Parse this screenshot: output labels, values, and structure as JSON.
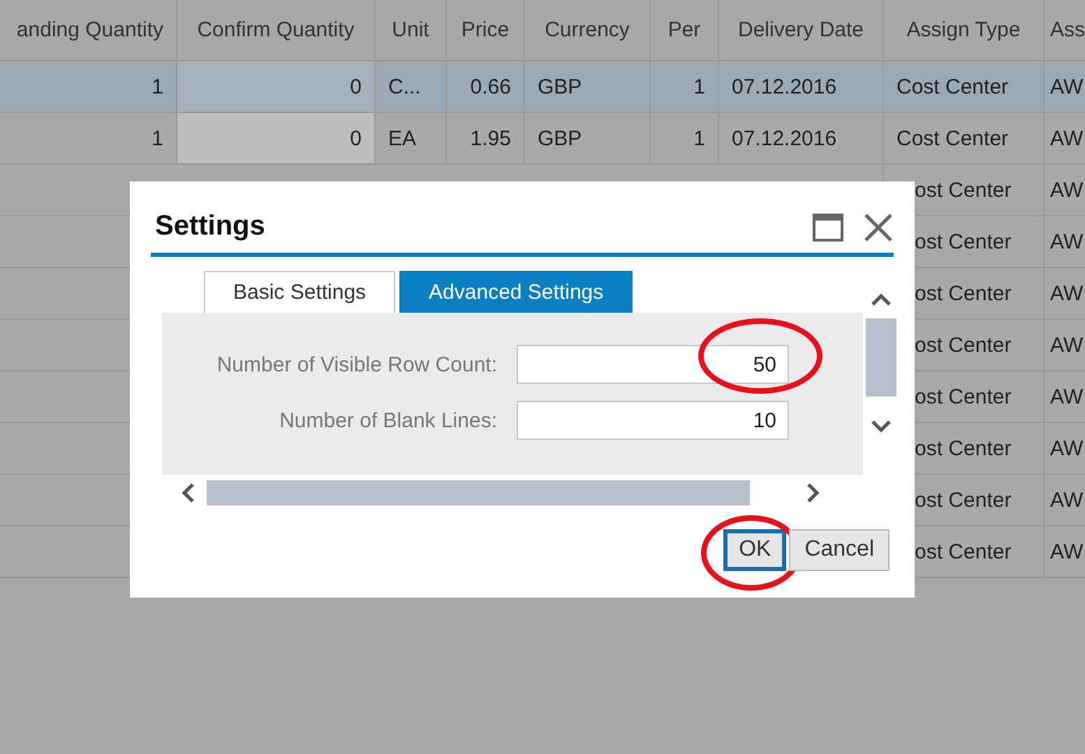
{
  "table": {
    "columns": [
      "anding Quantity",
      "Confirm Quantity",
      "Unit",
      "Price",
      "Currency",
      "Per",
      "Delivery Date",
      "Assign Type",
      "Ass"
    ],
    "rows": [
      {
        "kind": "full",
        "selected": true,
        "cells": [
          "1",
          "0",
          "C...",
          "0.66",
          "GBP",
          "1",
          "07.12.2016",
          "Cost Center",
          "AW"
        ]
      },
      {
        "kind": "full",
        "selected": false,
        "cells": [
          "1",
          "0",
          "EA",
          "1.95",
          "GBP",
          "1",
          "07.12.2016",
          "Cost Center",
          "AW"
        ]
      },
      {
        "kind": "covered",
        "selected": false,
        "cells": [
          "ost Center",
          "AW"
        ]
      },
      {
        "kind": "covered",
        "selected": false,
        "cells": [
          "ost Center",
          "AW"
        ]
      },
      {
        "kind": "covered",
        "selected": false,
        "cells": [
          "ost Center",
          "AW"
        ]
      },
      {
        "kind": "covered",
        "selected": false,
        "cells": [
          "ost Center",
          "AW"
        ]
      },
      {
        "kind": "covered",
        "selected": false,
        "cells": [
          "ost Center",
          "AW"
        ]
      },
      {
        "kind": "covered",
        "selected": false,
        "cells": [
          "ost Center",
          "AW"
        ]
      },
      {
        "kind": "covered",
        "selected": false,
        "cells": [
          "ost Center",
          "AW"
        ]
      },
      {
        "kind": "covered",
        "selected": false,
        "cells": [
          "ost Center",
          "AW"
        ]
      }
    ]
  },
  "dialog": {
    "title": "Settings",
    "tabs": [
      {
        "label": "Basic Settings",
        "selected": false
      },
      {
        "label": "Advanced Settings",
        "selected": true
      }
    ],
    "fields": [
      {
        "label": "Number of Visible Row Count:",
        "value": "50",
        "highlighted": true
      },
      {
        "label": "Number of Blank Lines:",
        "value": "10",
        "highlighted": false
      }
    ],
    "buttons": [
      {
        "label": "OK",
        "kind": "primary",
        "highlighted": true
      },
      {
        "label": "Cancel",
        "kind": "secondary",
        "highlighted": false
      }
    ]
  }
}
